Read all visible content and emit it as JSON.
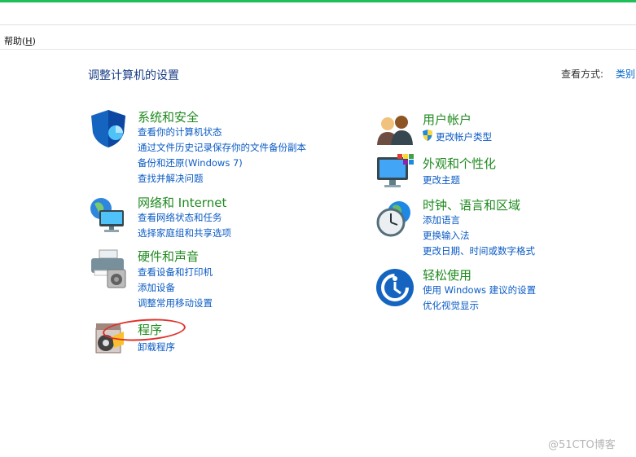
{
  "menu": {
    "help_label": "帮助(",
    "help_key": "H",
    "help_close": ")"
  },
  "header": {
    "title": "调整计算机的设置",
    "view_by_label": "查看方式:",
    "view_by_value": "类别"
  },
  "categories": {
    "system": {
      "title": "系统和安全",
      "links": [
        "查看你的计算机状态",
        "通过文件历史记录保存你的文件备份副本",
        "备份和还原(Windows 7)",
        "查找并解决问题"
      ],
      "icon": "shield-icon"
    },
    "network": {
      "title": "网络和 Internet",
      "links": [
        "查看网络状态和任务",
        "选择家庭组和共享选项"
      ],
      "icon": "network-globe-icon"
    },
    "hardware": {
      "title": "硬件和声音",
      "links": [
        "查看设备和打印机",
        "添加设备",
        "调整常用移动设置"
      ],
      "icon": "printer-speaker-icon"
    },
    "programs": {
      "title": "程序",
      "links": [
        "卸载程序"
      ],
      "icon": "programs-box-icon"
    },
    "users": {
      "title": "用户帐户",
      "links": [
        "更改帐户类型"
      ],
      "icon": "users-icon",
      "link_icon": "uac-shield-icon"
    },
    "appearance": {
      "title": "外观和个性化",
      "links": [
        "更改主题"
      ],
      "icon": "monitor-palette-icon"
    },
    "clock": {
      "title": "时钟、语言和区域",
      "links": [
        "添加语言",
        "更换输入法",
        "更改日期、时间或数字格式"
      ],
      "icon": "clock-globe-icon"
    },
    "ease": {
      "title": "轻松使用",
      "links": [
        "使用 Windows 建议的设置",
        "优化视觉显示"
      ],
      "icon": "ease-of-access-icon"
    }
  },
  "watermark": "@51CTO博客",
  "colors": {
    "title_green": "#1f8a1f",
    "link_blue": "#0a5bc4",
    "top_bar": "#1fbf5a",
    "annotation_red": "#e0302a"
  }
}
